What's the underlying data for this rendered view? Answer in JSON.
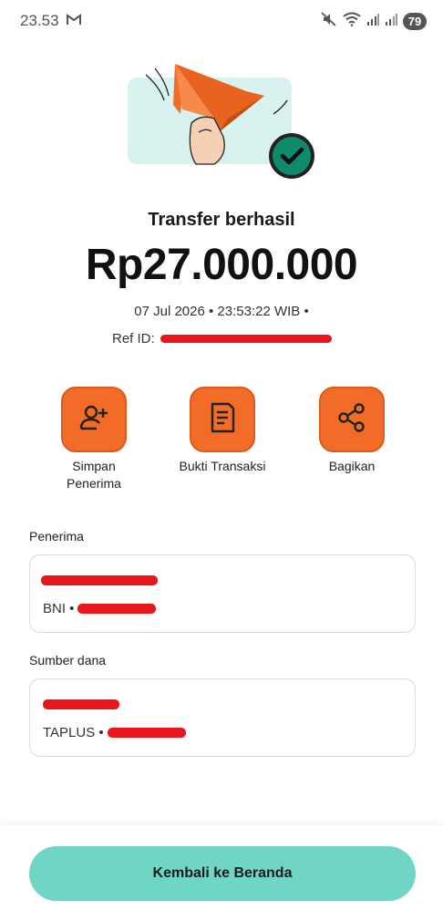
{
  "status_bar": {
    "time": "23.53",
    "mail_icon": "gmail-icon",
    "battery": "79"
  },
  "transfer": {
    "title": "Transfer berhasil",
    "amount": "Rp27.000.000",
    "datetime": "07 Jul 2026 • 23:53:22 WIB •",
    "ref_label": "Ref ID:"
  },
  "actions": [
    {
      "label": "Simpan Penerima",
      "icon": "add-user-icon"
    },
    {
      "label": "Bukti Transaksi",
      "icon": "receipt-icon"
    },
    {
      "label": "Bagikan",
      "icon": "share-icon"
    }
  ],
  "recipient": {
    "section_label": "Penerima",
    "bank": "BNI •"
  },
  "source": {
    "section_label": "Sumber dana",
    "account": "TAPLUS •"
  },
  "footer": {
    "home_button": "Kembali ke Beranda"
  },
  "colors": {
    "accent_orange": "#f26b27",
    "accent_teal": "#6fd6c6",
    "success_green": "#0f8a6a",
    "redaction": "#e8161c"
  }
}
